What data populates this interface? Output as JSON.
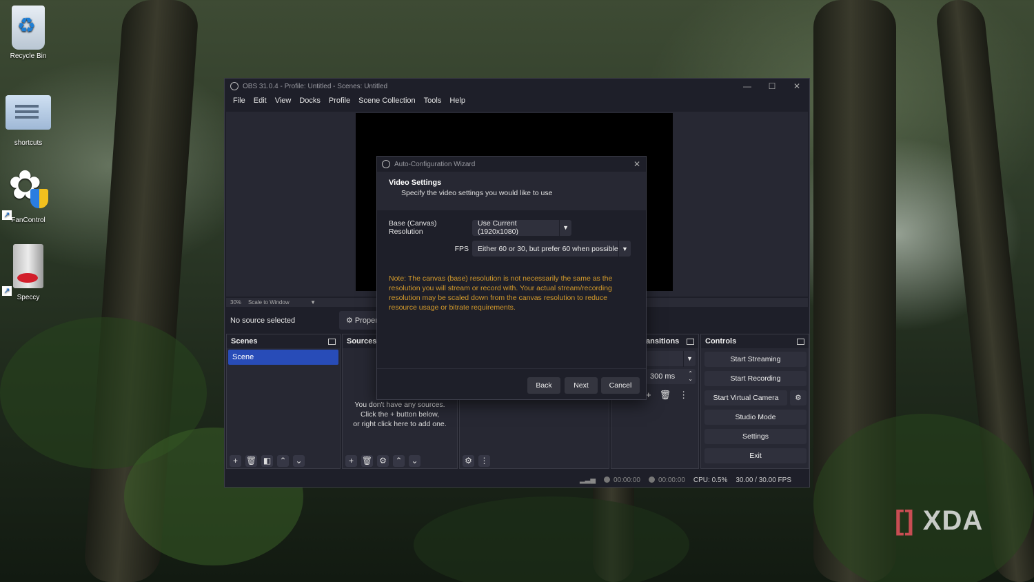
{
  "desktop": {
    "icons": [
      {
        "label": "Recycle Bin"
      },
      {
        "label": "shortcuts"
      },
      {
        "label": "FanControl"
      },
      {
        "label": "Speccy"
      }
    ],
    "watermark": "XDA"
  },
  "obs": {
    "title": "OBS 31.0.4 - Profile: Untitled - Scenes: Untitled",
    "menu": [
      "File",
      "Edit",
      "View",
      "Docks",
      "Profile",
      "Scene Collection",
      "Tools",
      "Help"
    ],
    "scale": {
      "zoom": "30%",
      "mode": "Scale to Window"
    },
    "source_bar": {
      "status": "No source selected",
      "properties_label": "Proper"
    },
    "scenes": {
      "title": "Scenes",
      "items": [
        "Scene"
      ]
    },
    "sources": {
      "title": "Sources",
      "empty_lines": [
        "You don't have any sources.",
        "Click the + button below,",
        "or right click here to add one."
      ]
    },
    "transitions": {
      "title": "ansitions",
      "duration": "300 ms"
    },
    "controls": {
      "title": "Controls",
      "buttons": [
        "Start Streaming",
        "Start Recording",
        "Start Virtual Camera",
        "Studio Mode",
        "Settings",
        "Exit"
      ]
    },
    "status": {
      "stream_time": "00:00:00",
      "record_time": "00:00:00",
      "cpu": "CPU: 0.5%",
      "fps": "30.00 / 30.00 FPS"
    }
  },
  "wizard": {
    "title": "Auto-Configuration Wizard",
    "heading": "Video Settings",
    "subheading": "Specify the video settings you would like to use",
    "resolution_label": "Base (Canvas) Resolution",
    "resolution_value": "Use Current (1920x1080)",
    "fps_label": "FPS",
    "fps_value": "Either 60 or 30, but prefer 60 when possible",
    "note": "Note: The canvas (base) resolution is not necessarily the same as the resolution you will stream or record with. Your actual stream/recording resolution may be scaled down from the canvas resolution to reduce resource usage or bitrate requirements.",
    "buttons": {
      "back": "Back",
      "next": "Next",
      "cancel": "Cancel"
    }
  }
}
